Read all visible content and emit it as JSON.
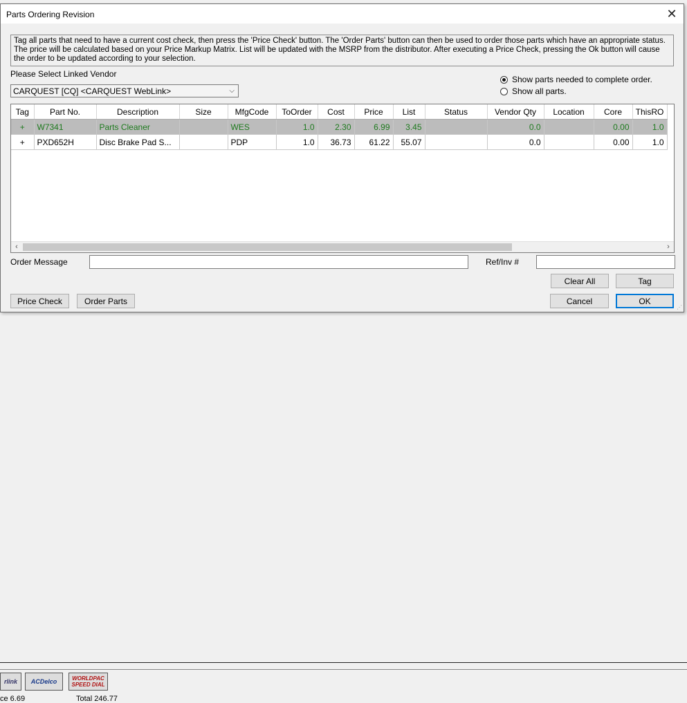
{
  "dialog": {
    "title": "Parts Ordering Revision",
    "instructions": "Tag all parts that need to have a current cost check, then press the 'Price Check' button.  The 'Order Parts' button can then be used to order those parts which have an appropriate status.  The price will be calculated based on your Price Markup Matrix. List will be updated with the MSRP from the distributor.  After executing a Price Check, pressing the Ok button will cause the order to be updated according to your selection.",
    "vendor_label": "Please Select Linked Vendor",
    "vendor_value": "CARQUEST [CQ] <CARQUEST WebLink>",
    "radio_complete": "Show parts needed to complete order.",
    "radio_all": "Show all parts.",
    "order_message_label": "Order Message",
    "order_message_value": "",
    "ref_label": "Ref/Inv #",
    "ref_value": ""
  },
  "grid": {
    "columns": [
      "Tag",
      "Part No.",
      "Description",
      "Size",
      "MfgCode",
      "ToOrder",
      "Cost",
      "Price",
      "List",
      "Status",
      "Vendor Qty",
      "Location",
      "Core",
      "ThisRO"
    ],
    "rows": [
      {
        "tag": "+",
        "part": "W7341",
        "desc": "Parts Cleaner",
        "size": "",
        "mfg": "WES",
        "toorder": "1.0",
        "cost": "2.30",
        "price": "6.99",
        "list": "3.45",
        "status": "",
        "vqty": "0.0",
        "loc": "",
        "core": "0.00",
        "thisro": "1.0",
        "selected": true
      },
      {
        "tag": "+",
        "part": "PXD652H",
        "desc": "Disc Brake Pad S...",
        "size": "",
        "mfg": "PDP",
        "toorder": "1.0",
        "cost": "36.73",
        "price": "61.22",
        "list": "55.07",
        "status": "",
        "vqty": "0.0",
        "loc": "",
        "core": "0.00",
        "thisro": "1.0",
        "selected": false
      }
    ]
  },
  "buttons": {
    "clear_all": "Clear All",
    "tag": "Tag",
    "price_check": "Price Check",
    "order_parts": "Order Parts",
    "cancel": "Cancel",
    "ok": "OK"
  },
  "background": {
    "link1": "rlink",
    "link2": "ACDelco",
    "link3": "WORLDPAC SPEED DIAL",
    "status_left": "ce   6.69",
    "status_total": "Total   246.77"
  },
  "colors": {
    "selected_row_bg": "#bcbcbc",
    "selected_row_text": "#1e7a1e",
    "ok_border": "#0078d7"
  }
}
